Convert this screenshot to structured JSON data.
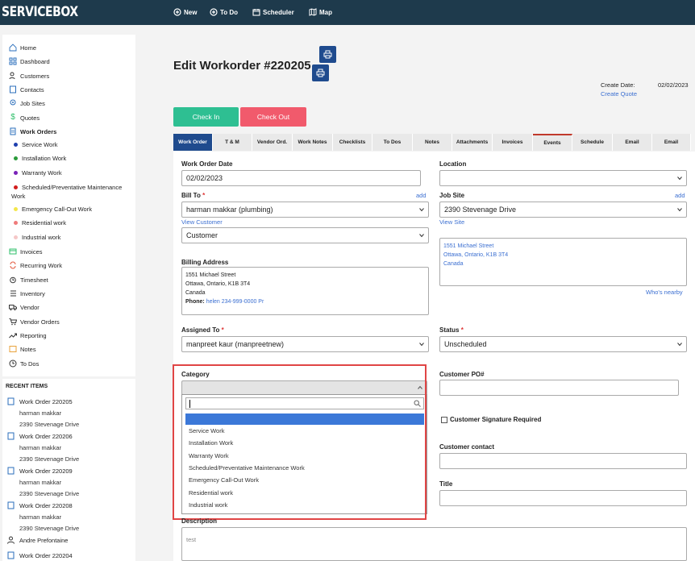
{
  "app": {
    "logo": "SERVICEBOX"
  },
  "topnav": {
    "new": "New",
    "todo": "To Do",
    "scheduler": "Scheduler",
    "map": "Map"
  },
  "sidebar": {
    "items": [
      "Home",
      "Dashboard",
      "Customers",
      "Contacts",
      "Job Sites",
      "Quotes",
      "Work Orders"
    ],
    "work_order_types": [
      {
        "label": "Service Work",
        "color": "#1f3fae"
      },
      {
        "label": "Installation Work",
        "color": "#2a9a3a"
      },
      {
        "label": "Warranty Work",
        "color": "#7a22b8"
      },
      {
        "label": "Scheduled/Preventative Maintenance Work",
        "color": "#d21e1e"
      },
      {
        "label": "Emergency Call-Out Work",
        "color": "#f3e64a"
      },
      {
        "label": "Residential work",
        "color": "#ef7b7b"
      },
      {
        "label": "Industrial work",
        "color": "#f5c7c7"
      }
    ],
    "items_after": [
      "Invoices",
      "Recurring Work",
      "Timesheet",
      "Inventory",
      "Vendor",
      "Vendor Orders",
      "Reporting",
      "Notes",
      "To Dos"
    ]
  },
  "recent": {
    "title": "RECENT ITEMS",
    "items": [
      {
        "title": "Work Order 220205",
        "customer": "harman makkar",
        "address": "2390 Stevenage Drive"
      },
      {
        "title": "Work Order 220206",
        "customer": "harman makkar",
        "address": "2390 Stevenage Drive"
      },
      {
        "title": "Work Order 220209",
        "customer": "harman makkar",
        "address": "2390 Stevenage Drive"
      },
      {
        "title": "Work Order 220208",
        "customer": "harman makkar",
        "address": "2390 Stevenage Drive"
      }
    ],
    "contact": "Andre Prefontaine",
    "last": "Work Order 220204"
  },
  "page": {
    "title": "Edit Workorder #220205",
    "create_date_label": "Create Date:",
    "create_date": "02/02/2023",
    "create_quote": "Create Quote",
    "check_in": "Check In",
    "check_out": "Check Out"
  },
  "tabs": [
    "Work Order",
    "T & M",
    "Vendor Ord.",
    "Work Notes",
    "Checklists",
    "To Dos",
    "Notes",
    "Attachments",
    "Invoices",
    "Events",
    "Schedule",
    "Email",
    "Email"
  ],
  "form": {
    "work_order_date_label": "Work Order Date",
    "work_order_date": "02/02/2023",
    "location_label": "Location",
    "location_value": "",
    "bill_to_label": "Bill To",
    "bill_to_value": "harman makkar (plumbing)",
    "add": "add",
    "view_customer": "View Customer",
    "customer_type": "Customer",
    "job_site_label": "Job Site",
    "job_site_value": "2390 Stevenage Drive",
    "view_site": "View Site",
    "site_address": [
      "1551 Michael Street",
      "Ottawa, Ontario, K1B 3T4",
      "Canada"
    ],
    "whos_nearby": "Who's nearby",
    "billing_address_label": "Billing Address",
    "billing_address": [
      "1551 Michael Street",
      "Ottawa, Ontario, K1B 3T4",
      "Canada"
    ],
    "phone_label": "Phone:",
    "phone_value": "helen 234-999-0000 Pr",
    "assigned_to_label": "Assigned To",
    "assigned_to_value": "manpreet kaur (manpreetnew)",
    "status_label": "Status",
    "status_value": "Unscheduled",
    "category_label": "Category",
    "customer_po_label": "Customer PO#",
    "customer_signature_label": "Customer Signature Required",
    "customer_contact_label": "Customer contact",
    "title_label": "Title",
    "description_label": "Description",
    "description_placeholder": "test"
  },
  "category_dropdown": {
    "search_value": "",
    "options": [
      "",
      "Service Work",
      "Installation Work",
      "Warranty Work",
      "Scheduled/Preventative Maintenance Work",
      "Emergency Call-Out Work",
      "Residential work",
      "Industrial work"
    ]
  }
}
